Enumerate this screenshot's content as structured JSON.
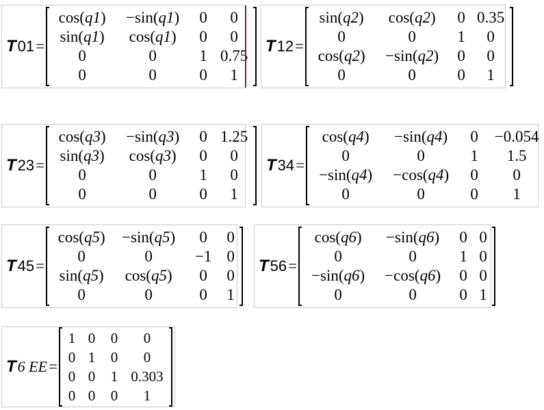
{
  "matrices": [
    {
      "id": "T01",
      "lhs": {
        "sym": "T",
        "sub": "01",
        "sub_italic": false
      },
      "rows": [
        [
          "cos(q1)",
          "−sin(q1)",
          "0",
          "0"
        ],
        [
          "sin(q1)",
          "cos(q1)",
          "0",
          "0"
        ],
        [
          "0",
          "0",
          "1",
          "0.75"
        ],
        [
          "0",
          "0",
          "0",
          "1"
        ]
      ]
    },
    {
      "id": "T12",
      "lhs": {
        "sym": "T",
        "sub": "12",
        "sub_italic": false
      },
      "rows": [
        [
          "sin(q2)",
          "cos(q2)",
          "0",
          "0.35"
        ],
        [
          "0",
          "0",
          "1",
          "0"
        ],
        [
          "cos(q2)",
          "−sin(q2)",
          "0",
          "0"
        ],
        [
          "0",
          "0",
          "0",
          "1"
        ]
      ]
    },
    {
      "id": "T23",
      "lhs": {
        "sym": "T",
        "sub": "23",
        "sub_italic": false
      },
      "rows": [
        [
          "cos(q3)",
          "−sin(q3)",
          "0",
          "1.25"
        ],
        [
          "sin(q3)",
          "cos(q3)",
          "0",
          "0"
        ],
        [
          "0",
          "0",
          "1",
          "0"
        ],
        [
          "0",
          "0",
          "0",
          "1"
        ]
      ]
    },
    {
      "id": "T34",
      "lhs": {
        "sym": "T",
        "sub": "34",
        "sub_italic": false
      },
      "rows": [
        [
          "cos(q4)",
          "−sin(q4)",
          "0",
          "−0.054"
        ],
        [
          "0",
          "0",
          "1",
          "1.5"
        ],
        [
          "−sin(q4)",
          "−cos(q4)",
          "0",
          "0"
        ],
        [
          "0",
          "0",
          "0",
          "1"
        ]
      ]
    },
    {
      "id": "T45",
      "lhs": {
        "sym": "T",
        "sub": "45",
        "sub_italic": false
      },
      "rows": [
        [
          "cos(q5)",
          "−sin(q5)",
          "0",
          "0"
        ],
        [
          "0",
          "0",
          "−1",
          "0"
        ],
        [
          "sin(q5)",
          "cos(q5)",
          "0",
          "0"
        ],
        [
          "0",
          "0",
          "0",
          "1"
        ]
      ]
    },
    {
      "id": "T56",
      "lhs": {
        "sym": "T",
        "sub": "56",
        "sub_italic": false
      },
      "rows": [
        [
          "cos(q6)",
          "−sin(q6)",
          "0",
          "0"
        ],
        [
          "0",
          "0",
          "1",
          "0"
        ],
        [
          "−sin(q6)",
          "−cos(q6)",
          "0",
          "0"
        ],
        [
          "0",
          "0",
          "0",
          "1"
        ]
      ]
    },
    {
      "id": "T6EE",
      "lhs": {
        "sym": "T",
        "sub": "6 EE",
        "sub_italic": true
      },
      "rows": [
        [
          "1",
          "0",
          "0",
          "0"
        ],
        [
          "0",
          "1",
          "0",
          "0"
        ],
        [
          "0",
          "0",
          "1",
          "0.303"
        ],
        [
          "0",
          "0",
          "0",
          "1"
        ]
      ]
    }
  ]
}
